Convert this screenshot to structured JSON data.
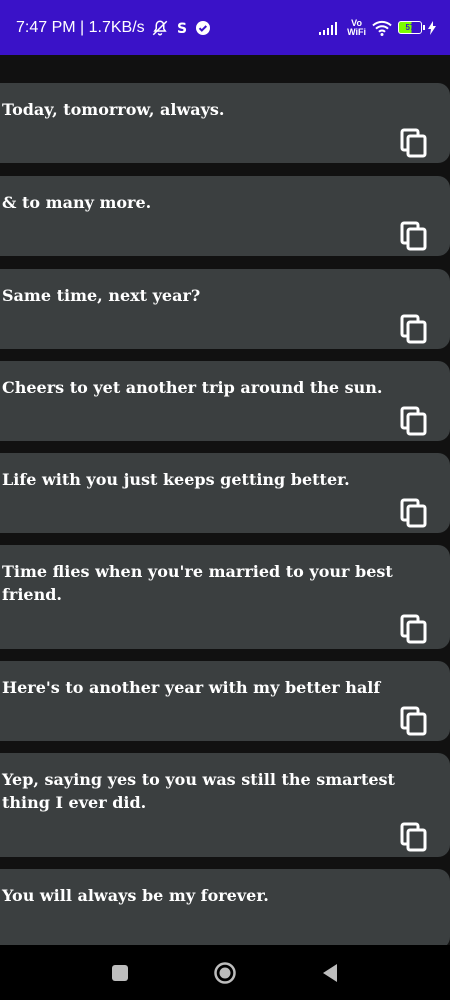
{
  "status_bar": {
    "time_speed": "7:47 PM | 1.7KB/s",
    "vowifi_top": "Vo",
    "vowifi_bottom": "WiFi",
    "battery_level": "57"
  },
  "messages": [
    {
      "text": "Today, tomorrow, always."
    },
    {
      "text": "& to many more."
    },
    {
      "text": "Same time, next year?"
    },
    {
      "text": "Cheers to yet another trip around the sun."
    },
    {
      "text": "Life with you just keeps getting better."
    },
    {
      "text": "Time flies when you're married to your best friend."
    },
    {
      "text": "Here's to another year with my better half"
    },
    {
      "text": "Yep, saying yes to you was still the smartest thing I ever did."
    },
    {
      "text": "You will always be my forever."
    }
  ],
  "colors": {
    "status_bar": "#3a12c8",
    "background": "#111111",
    "card": "#3b3f40",
    "text": "#ffffff"
  },
  "icons": {
    "copy": "copy-icon",
    "recents": "square-icon",
    "home": "circle-icon",
    "back": "triangle-back-icon"
  }
}
